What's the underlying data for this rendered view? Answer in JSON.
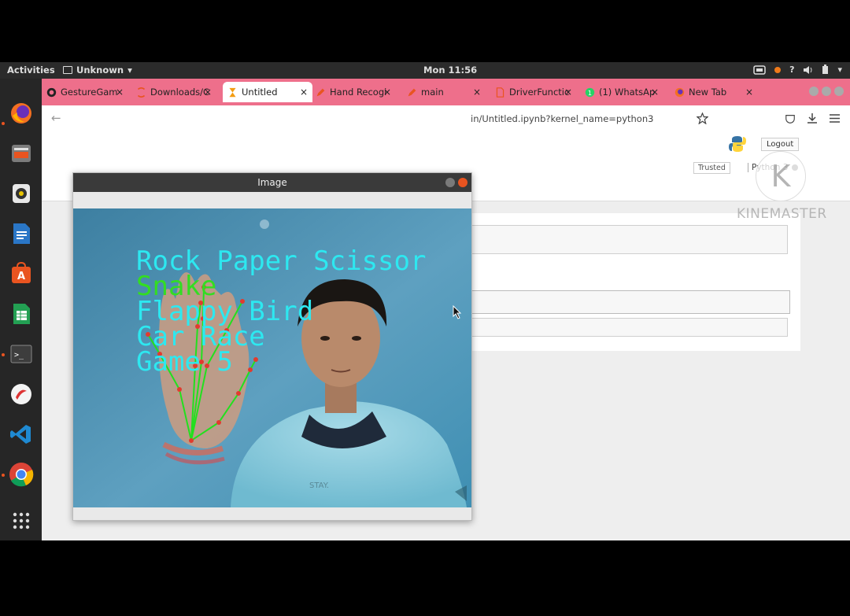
{
  "topbar": {
    "activities": "Activities",
    "app_menu": "Unknown",
    "clock": "Mon 11:56"
  },
  "browser": {
    "tabs": [
      {
        "label": "GestureGam",
        "icon": "github-icon",
        "active": false
      },
      {
        "label": "Downloads/C",
        "icon": "jupyter-tab-icon",
        "active": false
      },
      {
        "label": "Untitled",
        "icon": "hourglass-icon",
        "active": true
      },
      {
        "label": "Hand Recogi",
        "icon": "edit-icon",
        "active": false
      },
      {
        "label": "main",
        "icon": "edit-icon",
        "active": false
      },
      {
        "label": "DriverFunctic",
        "icon": "document-icon",
        "active": false
      },
      {
        "label": "(1) WhatsAp",
        "icon": "whatsapp-icon",
        "active": false
      },
      {
        "label": "New Tab",
        "icon": "firefox-icon",
        "active": false
      }
    ],
    "url": "in/Untitled.ipynb?kernel_name=python3",
    "tab_close_glyph": "×"
  },
  "notebook": {
    "logout": "Logout",
    "trusted": "Trusted",
    "kernel": "Python 3"
  },
  "image_window": {
    "title": "Image",
    "menu": [
      {
        "text": "Rock Paper Scissor",
        "color": "#2de8f0"
      },
      {
        "text": "Snake",
        "color": "#33dd22"
      },
      {
        "text": "Flappy Bird",
        "color": "#2de8f0"
      },
      {
        "text": "Car Race",
        "color": "#2de8f0"
      },
      {
        "text": "Game 5",
        "color": "#2de8f0"
      }
    ],
    "shirt_text": "STAY."
  },
  "watermark": {
    "brand": "KINEMASTER",
    "letter": "K"
  },
  "colors": {
    "tabbar": "#ee6f8b",
    "ubuntu_orange": "#e95420"
  }
}
